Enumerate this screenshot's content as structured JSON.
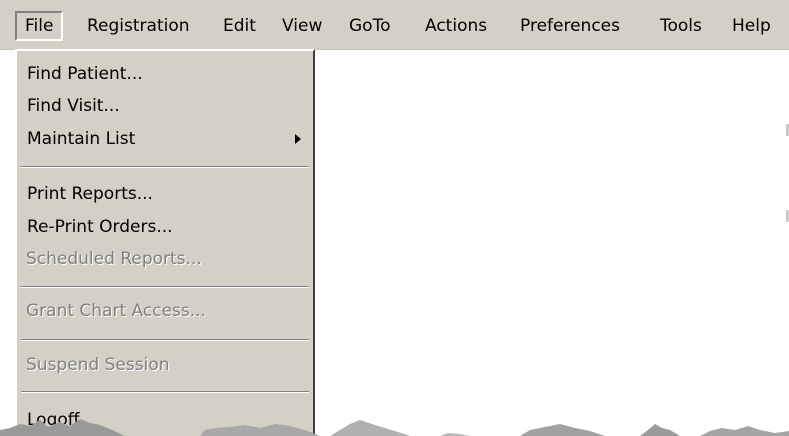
{
  "menubar": {
    "items": [
      {
        "label": "File"
      },
      {
        "label": "Registration"
      },
      {
        "label": "Edit"
      },
      {
        "label": "View"
      },
      {
        "label": "GoTo"
      },
      {
        "label": "Actions"
      },
      {
        "label": "Preferences"
      },
      {
        "label": "Tools"
      },
      {
        "label": "Help"
      }
    ]
  },
  "file_menu": {
    "items": [
      {
        "label": "Find Patient...",
        "enabled": true
      },
      {
        "label": "Find Visit...",
        "enabled": true
      },
      {
        "label": "Maintain List",
        "enabled": true,
        "submenu": true
      },
      {
        "label": "Print Reports...",
        "enabled": true
      },
      {
        "label": "Re-Print Orders...",
        "enabled": true
      },
      {
        "label": "Scheduled Reports...",
        "enabled": false
      },
      {
        "label": "Grant Chart Access...",
        "enabled": false
      },
      {
        "label": "Suspend Session",
        "enabled": false
      },
      {
        "label": "Logoff",
        "enabled": true
      }
    ]
  },
  "colors": {
    "menu_bg": "#d4d0c8",
    "disabled_text": "#808080",
    "highlight": "#ffffff"
  },
  "icons": {
    "submenu_arrow": "chevron-right-icon"
  }
}
